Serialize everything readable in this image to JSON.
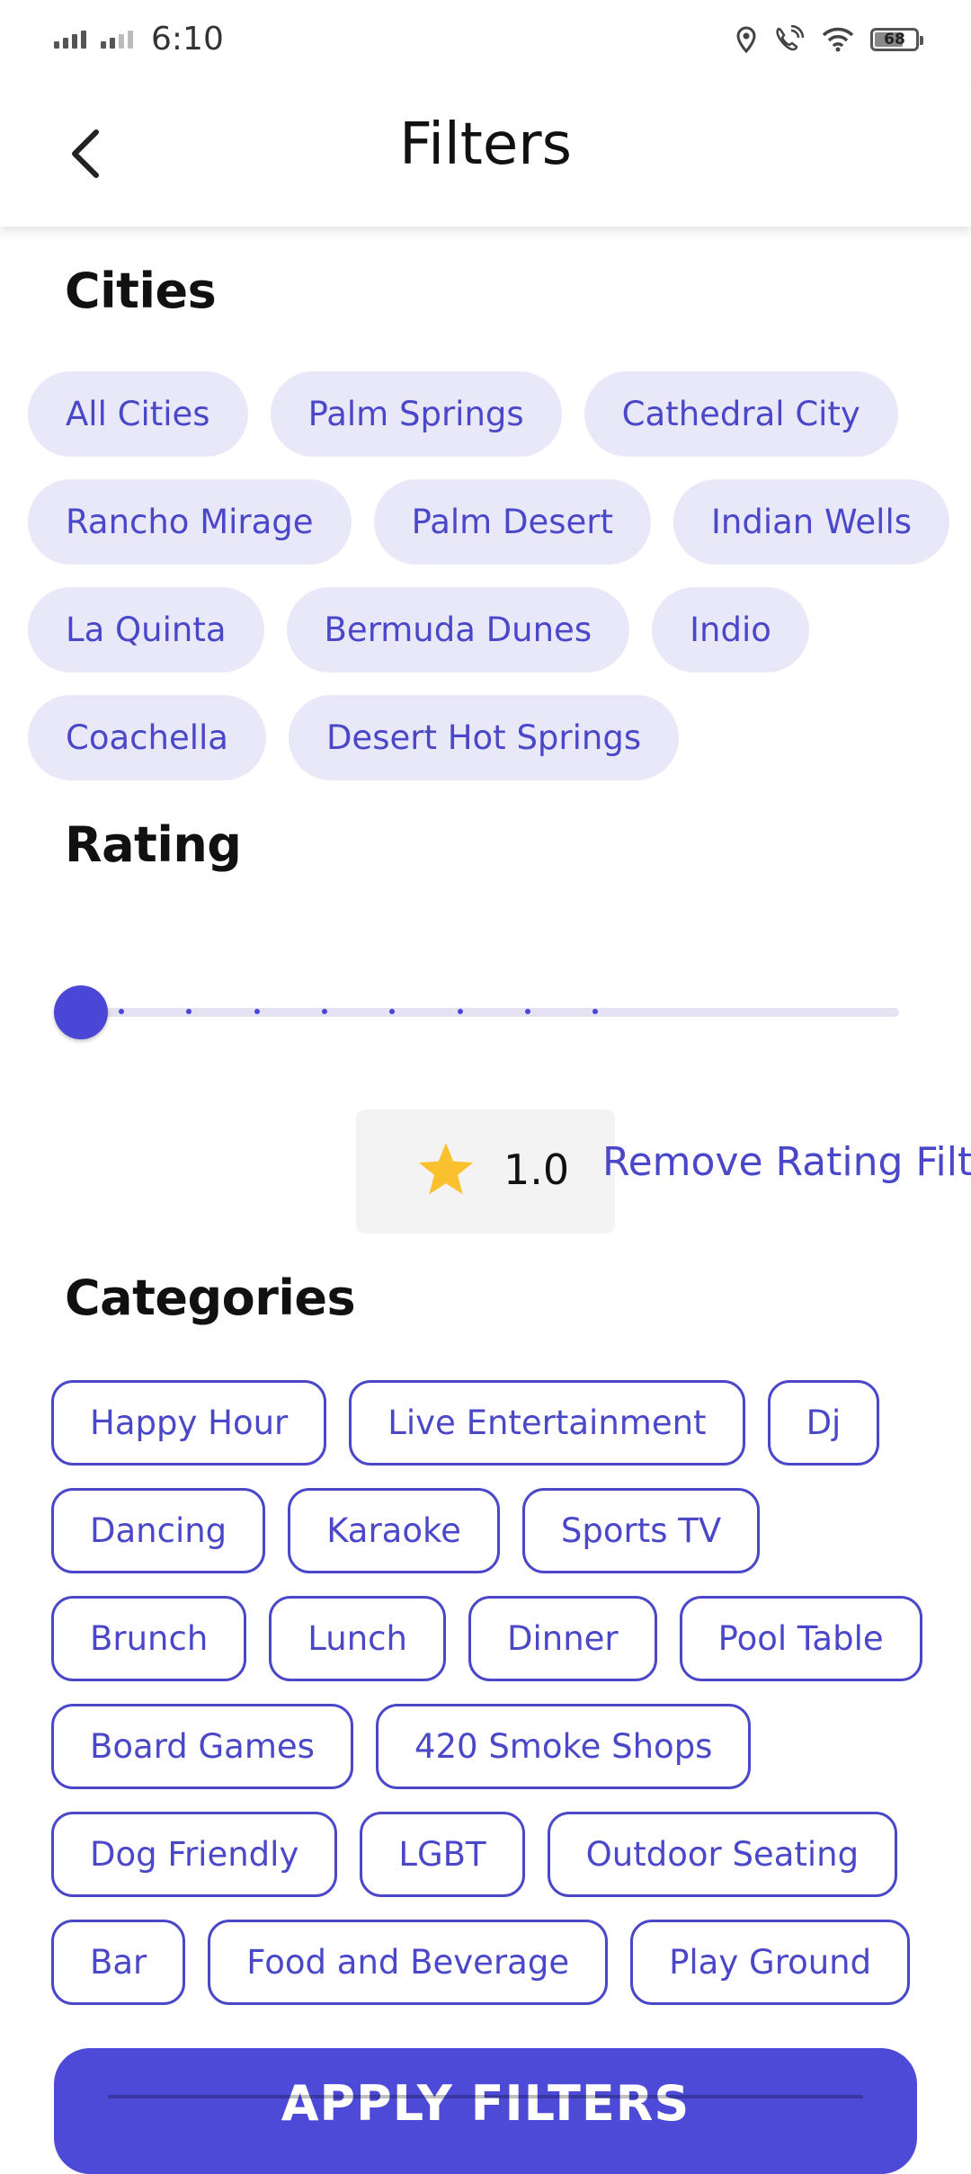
{
  "status_bar": {
    "time": "6:10",
    "battery": "68",
    "icons": [
      "signal-icon",
      "signal-icon",
      "location-icon",
      "wifi-call-icon",
      "wifi-icon",
      "battery-icon"
    ]
  },
  "header": {
    "title": "Filters",
    "back_icon": "chevron-left-icon"
  },
  "cities": {
    "title": "Cities",
    "items": [
      {
        "label": "All Cities"
      },
      {
        "label": "Palm Springs"
      },
      {
        "label": "Cathedral City"
      },
      {
        "label": "Rancho Mirage"
      },
      {
        "label": "Palm Desert"
      },
      {
        "label": "Indian Wells"
      },
      {
        "label": "La Quinta"
      },
      {
        "label": "Bermuda Dunes"
      },
      {
        "label": "Indio"
      },
      {
        "label": "Coachella"
      },
      {
        "label": "Desert Hot Springs"
      }
    ]
  },
  "rating": {
    "title": "Rating",
    "value": "1.0",
    "slider_fraction": 0,
    "star_icon": "star-icon",
    "remove_label": "Remove Rating Filte"
  },
  "categories": {
    "title": "Categories",
    "items": [
      {
        "label": "Happy Hour"
      },
      {
        "label": "Live Entertainment"
      },
      {
        "label": "Dj"
      },
      {
        "label": "Dancing"
      },
      {
        "label": "Karaoke"
      },
      {
        "label": "Sports TV"
      },
      {
        "label": "Brunch"
      },
      {
        "label": "Lunch"
      },
      {
        "label": "Dinner"
      },
      {
        "label": "Pool Table"
      },
      {
        "label": "Board Games"
      },
      {
        "label": "420 Smoke Shops"
      },
      {
        "label": "Dog Friendly"
      },
      {
        "label": "LGBT"
      },
      {
        "label": "Outdoor Seating"
      },
      {
        "label": "Bar"
      },
      {
        "label": "Food and Beverage"
      },
      {
        "label": "Play Ground"
      }
    ]
  },
  "apply_button": {
    "label": "APPLY FILTERS"
  },
  "colors": {
    "accent": "#4a47c9",
    "chip_bg": "#e9e8f9",
    "star": "#fbc02d",
    "button": "#4d4ad8"
  }
}
